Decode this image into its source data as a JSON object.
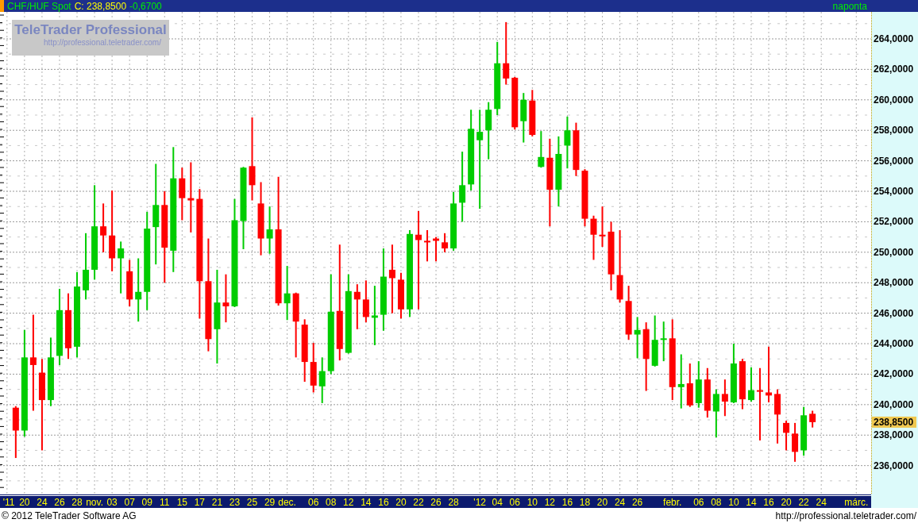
{
  "header": {
    "symbol": "CHF/HUF Spot",
    "close": "C: 238,8500",
    "change": "-0,6700",
    "period": "naponta"
  },
  "logo": {
    "name": "TeleTrader Professional",
    "url": "http://professional.teletrader.com/"
  },
  "chart": {
    "price_axis": [
      "264,0000",
      "262,0000",
      "260,0000",
      "258,0000",
      "256,0000",
      "254,0000",
      "252,0000",
      "250,0000",
      "248,0000",
      "246,0000",
      "244,0000",
      "242,0000",
      "240,0000",
      "238,0000",
      "236,0000"
    ],
    "last_price": "238,8500",
    "date_axis": [
      "'11",
      "20",
      "24",
      "26",
      "28",
      "nov.",
      "03",
      "07",
      "09",
      "11",
      "15",
      "17",
      "21",
      "23",
      "25",
      "29",
      "dec.",
      "06",
      "08",
      "12",
      "14",
      "16",
      "20",
      "22",
      "26",
      "28",
      "'12",
      "04",
      "06",
      "10",
      "12",
      "16",
      "18",
      "20",
      "24",
      "26",
      "febr.",
      "06",
      "08",
      "10",
      "14",
      "16",
      "20",
      "22",
      "24",
      "márc."
    ]
  },
  "footer": {
    "copyright": "© 2012 TeleTrader Software AG",
    "url": "http://professional.teletrader.com/"
  }
}
